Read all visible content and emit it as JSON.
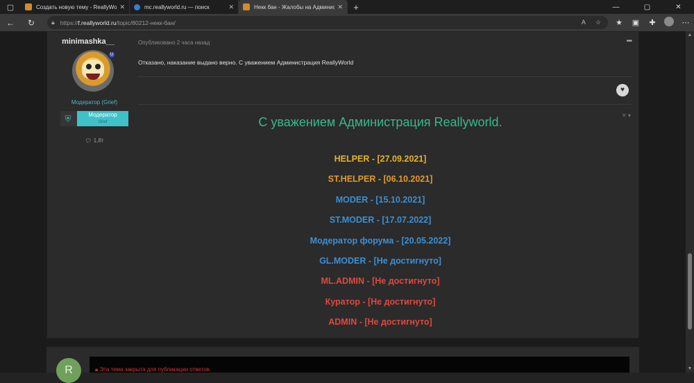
{
  "browser": {
    "tabs": [
      {
        "title": "Создать новую тему - ReallyWorld",
        "favicon": "reallyworld-icon",
        "active": false
      },
      {
        "title": "mc.reallyworld.ru — поиск",
        "favicon": "bing-search-icon",
        "active": false
      },
      {
        "title": "Некк бан - Жалобы на Администрацию",
        "favicon": "reallyworld-icon",
        "active": true
      }
    ],
    "url_prefix": "https://",
    "url_host": "f.reallyworld.ru",
    "url_path": "/topic/80212-некк-бан/"
  },
  "post": {
    "author": "minimashka__",
    "group": "Модератор (Grief)",
    "rank_label": "Модератор",
    "rank_sub": "Grief",
    "posts_count": "1,8т",
    "published": "Опубликовано 2 часа назад",
    "message": "Отказано, наказание выдано верно. С уважением Администрация ReallyWorld"
  },
  "signature": {
    "heading": "С уважением Администрация Reallyworld.",
    "lines": [
      {
        "text": "HELPER - [27.09.2021]",
        "color": "#e6b422"
      },
      {
        "text": "ST.HELPER - [06.10.2021]",
        "color": "#e39a2a"
      },
      {
        "text": "MODER - [15.10.2021]",
        "color": "#3b8fd6"
      },
      {
        "text": "ST.MODER - [17.07.2022]",
        "color": "#3b8fd6"
      },
      {
        "text": "Модератор форума - [20.05.2022]",
        "color": "#3b8fd6"
      },
      {
        "text": "GL.MODER - [Не достигнуто]",
        "color": "#3b8fd6"
      },
      {
        "text": "ML.ADMIN - [Не достигнуто]",
        "color": "#e0483d"
      },
      {
        "text": "Куратор - [Не достигнуто]",
        "color": "#e0483d"
      },
      {
        "text": "ADMIN - [Не достигнуто]",
        "color": "#e0483d"
      }
    ]
  },
  "next_post": {
    "avatar_letter": "R",
    "notice": "Эта тема закрыта для публикации ответов."
  }
}
